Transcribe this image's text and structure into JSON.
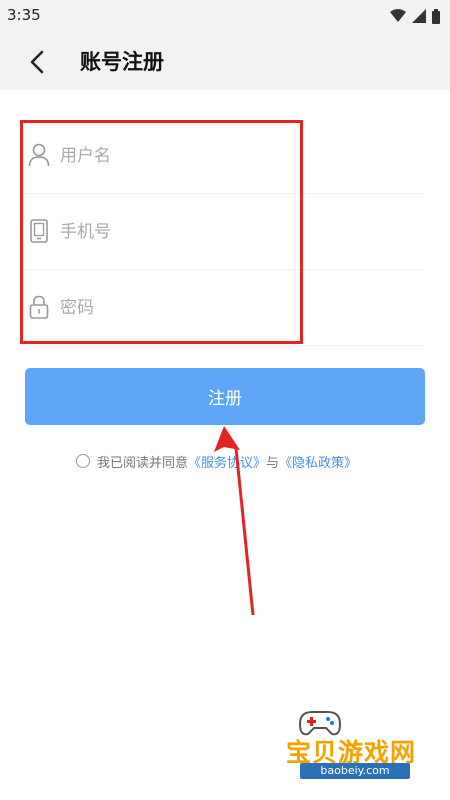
{
  "status_bar": {
    "time": "3:35"
  },
  "header": {
    "title": "账号注册"
  },
  "form": {
    "username_placeholder": "用户名",
    "phone_placeholder": "手机号",
    "password_placeholder": "密码",
    "username_value": "",
    "phone_value": "",
    "password_value": ""
  },
  "register_button": {
    "label": "注册"
  },
  "agreement": {
    "prefix": "我已阅读并同意",
    "service_link": "《服务协议》",
    "connector": "与",
    "privacy_link": "《隐私政策》"
  },
  "watermark": {
    "brand": "宝贝游戏网",
    "domain": "baobeiy.com"
  },
  "colors": {
    "accent": "#5ea5f8",
    "link": "#4a90e2",
    "annotation_red": "#e52323",
    "header_bg": "#f2f2f2"
  },
  "icons": {
    "back": "chevron-left-icon",
    "username": "user-icon",
    "phone": "phone-icon",
    "password": "lock-icon"
  }
}
